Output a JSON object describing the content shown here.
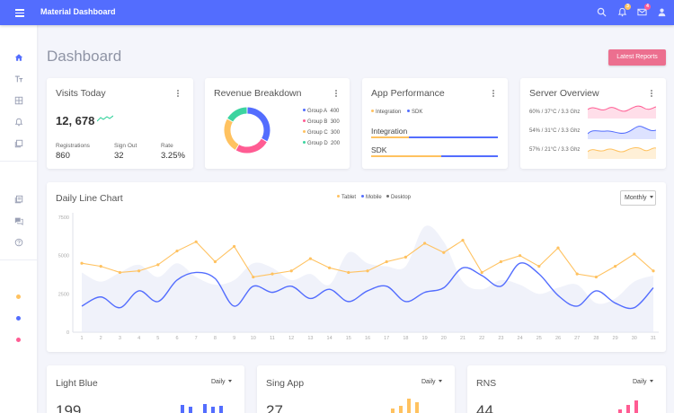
{
  "header": {
    "brand": "Material Dashboard",
    "bar_color": "#536dfe",
    "icons": [
      {
        "name": "search-icon"
      },
      {
        "name": "notifications-icon",
        "badge": "3",
        "badge_color": "#ffc260"
      },
      {
        "name": "mail-icon",
        "badge": "4",
        "badge_color": "#ff5c93"
      },
      {
        "name": "account-icon"
      }
    ]
  },
  "sidebar": {
    "items": [
      {
        "name": "home-icon",
        "active": true
      },
      {
        "name": "typography-icon"
      },
      {
        "name": "tables-icon"
      },
      {
        "name": "notifications-icon"
      },
      {
        "name": "ui-elements-icon"
      },
      {
        "name": "library-icon"
      },
      {
        "name": "support-icon"
      },
      {
        "name": "faq-icon"
      }
    ],
    "dots": [
      "#ffc260",
      "#536dfe",
      "#ff5c93"
    ]
  },
  "page": {
    "title": "Dashboard",
    "latest_reports": "Latest Reports"
  },
  "visits": {
    "title": "Visits Today",
    "total": "12, 678",
    "stats": [
      {
        "label": "Registrations",
        "value": "860"
      },
      {
        "label": "Sign Out",
        "value": "32"
      },
      {
        "label": "Rate",
        "value": "3.25%"
      }
    ]
  },
  "revenue": {
    "title": "Revenue Breakdown",
    "groups": [
      {
        "label": "Group A",
        "value": "400",
        "color": "#536dfe"
      },
      {
        "label": "Group B",
        "value": "300",
        "color": "#ff5c93"
      },
      {
        "label": "Group C",
        "value": "300",
        "color": "#ffc260"
      },
      {
        "label": "Group D",
        "value": "200",
        "color": "#3cd4a0"
      }
    ]
  },
  "performance": {
    "title": "App Performance",
    "legend": [
      {
        "label": "Integration",
        "color": "#ffc260"
      },
      {
        "label": "SDK",
        "color": "#536dfe"
      }
    ],
    "bars": [
      {
        "label": "Integration",
        "progress": 0.3
      },
      {
        "label": "SDK",
        "progress": 0.55
      }
    ]
  },
  "server": {
    "title": "Server Overview",
    "rows": [
      {
        "text": "60% / 37°C / 3.3 Ghz",
        "color": "#ff5c93"
      },
      {
        "text": "54% / 31°C / 3.3 Ghz",
        "color": "#536dfe"
      },
      {
        "text": "57% / 21°C / 3.3 Ghz",
        "color": "#ffc260"
      }
    ]
  },
  "daily_chart": {
    "title": "Daily Line Chart",
    "period": "Monthly",
    "legend": [
      {
        "label": "Tablet",
        "color": "#ffc260"
      },
      {
        "label": "Mobile",
        "color": "#536dfe"
      },
      {
        "label": "Desktop",
        "color": "#6e6e6e"
      }
    ]
  },
  "chart_data": {
    "type": "line",
    "x": [
      1,
      2,
      3,
      4,
      5,
      6,
      7,
      8,
      9,
      10,
      11,
      12,
      13,
      14,
      15,
      16,
      17,
      18,
      19,
      20,
      21,
      22,
      23,
      24,
      25,
      26,
      27,
      28,
      29,
      30,
      31
    ],
    "ylim": [
      0,
      7500
    ],
    "yticks": [
      "7500",
      "5000",
      "2500",
      "0"
    ],
    "series": [
      {
        "name": "Tablet",
        "color": "#ffc260",
        "values": [
          4500,
          4300,
          3900,
          4000,
          4400,
          5300,
          5900,
          4600,
          5600,
          3600,
          3800,
          4000,
          4800,
          4200,
          3900,
          4000,
          4600,
          4900,
          5800,
          5200,
          6000,
          3900,
          4600,
          5000,
          4300,
          5500,
          3800,
          3600,
          4300,
          5100,
          4000
        ]
      },
      {
        "name": "Mobile",
        "color": "#536dfe",
        "values": [
          1700,
          2300,
          1600,
          2700,
          2000,
          3400,
          3900,
          3500,
          1700,
          3000,
          2600,
          3000,
          2200,
          2800,
          2000,
          2700,
          3000,
          2000,
          2600,
          2900,
          4200,
          3700,
          3000,
          4500,
          3800,
          2400,
          1700,
          2700,
          1900,
          1600,
          2900
        ]
      },
      {
        "name": "Desktop",
        "color": "#e4e7f5",
        "values": [
          3900,
          3300,
          3900,
          4400,
          3600,
          4500,
          3600,
          3100,
          3400,
          4500,
          4200,
          3400,
          3800,
          3100,
          5200,
          4500,
          4300,
          4300,
          6900,
          5900,
          3300,
          2800,
          3400,
          3100,
          2500,
          2900,
          3100,
          1900,
          2200,
          3300,
          3700
        ]
      }
    ]
  },
  "bottom_cards": [
    {
      "title": "Light Blue",
      "period": "Daily",
      "value": "199",
      "color": "#536dfe"
    },
    {
      "title": "Sing App",
      "period": "Daily",
      "value": "27",
      "color": "#ffc260"
    },
    {
      "title": "RNS",
      "period": "Daily",
      "value": "44",
      "color": "#ff5c93"
    }
  ]
}
